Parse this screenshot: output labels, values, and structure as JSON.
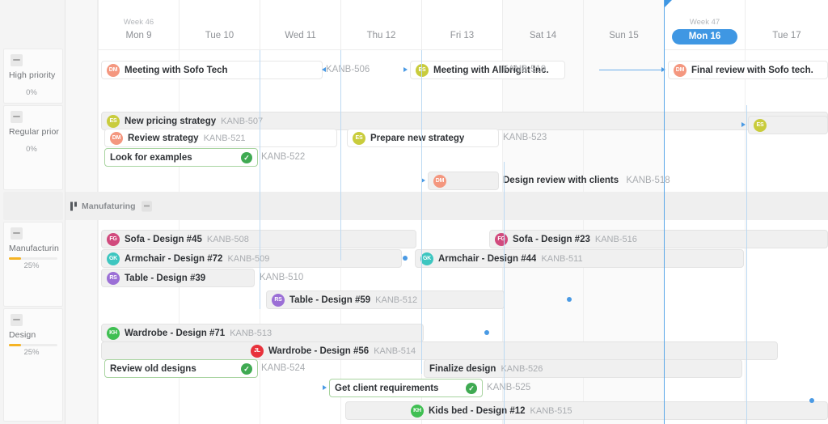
{
  "colors": {
    "accent": "#3f97e3",
    "today_line": "#5aa7e8",
    "progress_fill": "#f5b324",
    "done_green": "#3faa52",
    "band_bg": "#efefef",
    "bar_bg": "#f0f0f0"
  },
  "header": {
    "week_labels": {
      "w46": "Week 46",
      "w47": "Week 47"
    },
    "days": [
      {
        "key": "mon9",
        "label": "Mon 9",
        "week": "Week 46",
        "weekend": false,
        "today": false
      },
      {
        "key": "tue10",
        "label": "Tue 10",
        "week": "",
        "weekend": false,
        "today": false
      },
      {
        "key": "wed11",
        "label": "Wed 11",
        "week": "",
        "weekend": false,
        "today": false
      },
      {
        "key": "thu12",
        "label": "Thu 12",
        "week": "",
        "weekend": false,
        "today": false
      },
      {
        "key": "fri13",
        "label": "Fri 13",
        "week": "",
        "weekend": false,
        "today": false
      },
      {
        "key": "sat14",
        "label": "Sat 14",
        "week": "",
        "weekend": true,
        "today": false
      },
      {
        "key": "sun15",
        "label": "Sun 15",
        "week": "",
        "weekend": true,
        "today": false
      },
      {
        "key": "mon16",
        "label": "Mon 16",
        "week": "Week 47",
        "weekend": false,
        "today": true
      },
      {
        "key": "tue17",
        "label": "Tue 17",
        "week": "",
        "weekend": false,
        "today": false
      }
    ]
  },
  "sidebar": {
    "groups": [
      {
        "title": "High priority",
        "percent": "0%",
        "fill": 0,
        "spacer": false
      },
      {
        "title": "Regular priority",
        "percent": "0%",
        "fill": 0,
        "spacer": false
      },
      {
        "title": "",
        "percent": "",
        "fill": 0,
        "spacer": true
      },
      {
        "title": "Manufacturing",
        "percent": "25%",
        "fill": 25,
        "spacer": false
      },
      {
        "title": "Design",
        "percent": "25%",
        "fill": 25,
        "spacer": false
      }
    ]
  },
  "sections": [
    {
      "label": "Manufaturing"
    }
  ],
  "avatars": {
    "DM": {
      "initials": "DM",
      "color": "#f4977f"
    },
    "ES": {
      "initials": "ES",
      "color": "#c9cc3c"
    },
    "FG": {
      "initials": "FG",
      "color": "#d14a7d"
    },
    "GK": {
      "initials": "GK",
      "color": "#3dc6c0"
    },
    "RS": {
      "initials": "RS",
      "color": "#9b6fd6"
    },
    "KH": {
      "initials": "KH",
      "color": "#3fbf52"
    },
    "JL": {
      "initials": "JL",
      "color": "#e8323c"
    }
  },
  "tasks": [
    {
      "id": "KANB-506",
      "title": "Meeting with Sofo Tech",
      "avatar": "DM",
      "code_inside": false,
      "code_side": "right",
      "done": false,
      "style": "white"
    },
    {
      "id": "KANB-519",
      "title": "Meeting with Allbright Inc.",
      "avatar": "ES",
      "code_inside": false,
      "code_side": "right",
      "done": false,
      "style": "white"
    },
    {
      "id": "",
      "title": "Final review with Sofo tech.",
      "avatar": "DM",
      "code_inside": false,
      "code_side": "none",
      "done": false,
      "style": "white"
    },
    {
      "id": "KANB-507",
      "title": "New pricing strategy",
      "avatar": "ES",
      "code_inside": true,
      "code_side": "none",
      "done": false,
      "style": "grey"
    },
    {
      "id": "KANB-521",
      "title": "Review strategy",
      "avatar": "DM",
      "code_inside": true,
      "code_side": "none",
      "done": false,
      "style": "white"
    },
    {
      "id": "KANB-523",
      "title": "Prepare new strategy",
      "avatar": "ES",
      "code_inside": false,
      "code_side": "right",
      "done": false,
      "style": "white"
    },
    {
      "id": "KANB-522",
      "title": "Look for examples",
      "avatar": "",
      "code_inside": false,
      "code_side": "right",
      "done": true,
      "style": "done"
    },
    {
      "id": "",
      "title": "",
      "avatar": "ES",
      "code_inside": false,
      "code_side": "none",
      "done": false,
      "style": "grey"
    },
    {
      "id": "KANB-518",
      "title": "Design review with clients",
      "avatar": "DM",
      "code_inside": false,
      "code_side": "right",
      "done": false,
      "style": "grey"
    },
    {
      "id": "KANB-508",
      "title": "Sofa - Design #45",
      "avatar": "FG",
      "code_inside": true,
      "code_side": "none",
      "done": false,
      "style": "grey"
    },
    {
      "id": "KANB-516",
      "title": "Sofa - Design #23",
      "avatar": "FG",
      "code_inside": true,
      "code_side": "none",
      "done": false,
      "style": "grey"
    },
    {
      "id": "KANB-509",
      "title": "Armchair - Design #72",
      "avatar": "GK",
      "code_inside": true,
      "code_side": "none",
      "done": false,
      "style": "grey"
    },
    {
      "id": "KANB-511",
      "title": "Armchair - Design #44",
      "avatar": "GK",
      "code_inside": true,
      "code_side": "none",
      "done": false,
      "style": "grey"
    },
    {
      "id": "KANB-510",
      "title": "Table - Design #39",
      "avatar": "RS",
      "code_inside": false,
      "code_side": "right",
      "done": false,
      "style": "grey"
    },
    {
      "id": "KANB-512",
      "title": "Table - Design #59",
      "avatar": "RS",
      "code_inside": true,
      "code_side": "none",
      "done": false,
      "style": "grey"
    },
    {
      "id": "KANB-513",
      "title": "Wardrobe - Design #71",
      "avatar": "KH",
      "code_inside": true,
      "code_side": "none",
      "done": false,
      "style": "grey"
    },
    {
      "id": "KANB-514",
      "title": "Wardrobe - Design #56",
      "avatar": "JL",
      "code_inside": true,
      "code_side": "none",
      "done": false,
      "style": "grey"
    },
    {
      "id": "KANB-524",
      "title": "Review old designs",
      "avatar": "",
      "code_inside": false,
      "code_side": "right",
      "done": true,
      "style": "done"
    },
    {
      "id": "KANB-526",
      "title": "Finalize design",
      "avatar": "",
      "code_inside": true,
      "code_side": "none",
      "done": false,
      "style": "grey"
    },
    {
      "id": "KANB-525",
      "title": "Get client requirements",
      "avatar": "",
      "code_inside": false,
      "code_side": "right",
      "done": true,
      "style": "done"
    },
    {
      "id": "KANB-515",
      "title": "Kids bed - Design #12",
      "avatar": "KH",
      "code_inside": true,
      "code_side": "none",
      "done": false,
      "style": "grey"
    }
  ]
}
